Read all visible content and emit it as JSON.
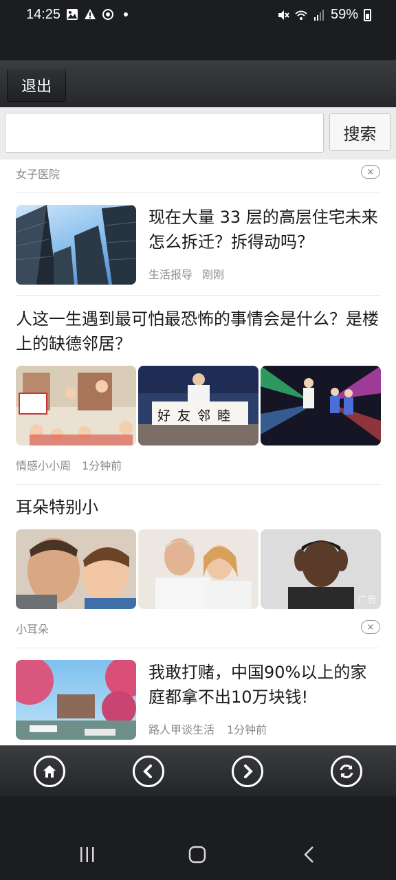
{
  "status_bar": {
    "time": "14:25",
    "battery": "59%",
    "left_icons": [
      "image-icon",
      "warning-icon",
      "sync-icon",
      "dot-icon"
    ],
    "right_icons": [
      "mute-icon",
      "wifi-icon",
      "signal-icon",
      "battery-icon"
    ]
  },
  "toolbar": {
    "exit_label": "退出"
  },
  "search": {
    "placeholder": "",
    "button_label": "搜索"
  },
  "feed": {
    "ad_top": {
      "source": "女子医院",
      "close": "×"
    },
    "article1": {
      "title": "现在大量 33 层的高层住宅未来怎么拆迁？拆得动吗？",
      "source": "生活报导",
      "time": "刚刚"
    },
    "article2": {
      "title": "人这一生遇到最可怕最恐怖的事情会是什么？是楼上的缺德邻居？",
      "source": "情感小小周",
      "time": "1分钟前",
      "banner_text": "好 友 邻 睦"
    },
    "ad2": {
      "title": "耳朵特别小",
      "source": "小耳朵",
      "ad_badge": "广告",
      "close": "×"
    },
    "article3": {
      "title": "我敢打赌，中国90%以上的家庭都拿不出10万块钱!",
      "source": "路人甲谈生活",
      "time": "1分钟前"
    }
  },
  "bottom_nav": {
    "buttons": [
      "home-icon",
      "back-icon",
      "forward-icon",
      "refresh-icon"
    ]
  },
  "system_nav": {
    "buttons": [
      "recents-icon",
      "home-icon",
      "back-icon"
    ]
  }
}
